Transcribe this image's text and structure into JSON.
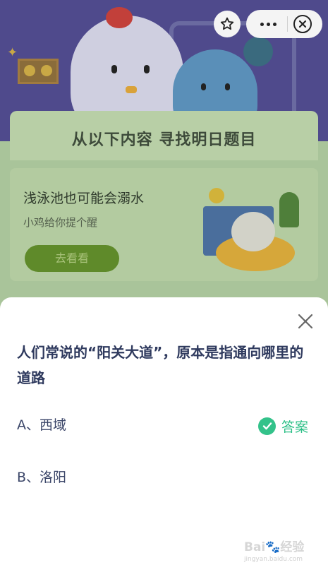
{
  "background": {
    "hunt_title": "从以下内容 寻找明日题目",
    "hint_card": {
      "title": "浅泳池也可能会溺水",
      "subtitle": "小鸡给你提个醒",
      "button_label": "去看看"
    }
  },
  "capsule": {
    "icons": [
      "star-icon",
      "more-icon",
      "close-circle-icon"
    ]
  },
  "quiz": {
    "question": "人们常说的“阳关大道”，原本是指通向哪里的道路",
    "options": [
      {
        "label": "A、西域",
        "is_answer": true
      },
      {
        "label": "B、洛阳",
        "is_answer": false
      }
    ],
    "answer_label": "答案"
  },
  "colors": {
    "accent_green": "#33c28a",
    "question_text": "#2f3a5e"
  }
}
